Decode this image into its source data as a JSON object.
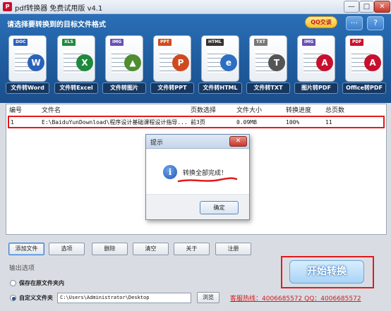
{
  "window": {
    "title": "pdf转换器 免费试用版 v4.1",
    "app_icon": "P",
    "minimize_glyph": "—",
    "maximize_glyph": "□",
    "close_glyph": "✕"
  },
  "format_panel": {
    "heading": "请选择要转换到的目标文件格式",
    "qq_button": "QQ交谈",
    "message_glyph": "···",
    "help_glyph": "?",
    "formats": [
      {
        "tag": "DOC",
        "label": "文件转Word",
        "tag_color": "#2b62b8",
        "glyph": "W",
        "glyph_color": "#2b62b8"
      },
      {
        "tag": "XLS",
        "label": "文件转Excel",
        "tag_color": "#1f8a3c",
        "glyph": "X",
        "glyph_color": "#1f8a3c"
      },
      {
        "tag": "IMG",
        "label": "文件转图片",
        "tag_color": "#6a4fb5",
        "glyph": "▲",
        "glyph_color": "#4f8d2f"
      },
      {
        "tag": "PPT",
        "label": "文件转PPT",
        "tag_color": "#d04a1f",
        "glyph": "P",
        "glyph_color": "#d04a1f"
      },
      {
        "tag": "HTML",
        "label": "文件转HTML",
        "tag_color": "#333333",
        "glyph": "e",
        "glyph_color": "#2c6fc2"
      },
      {
        "tag": "TXT",
        "label": "文件转TXT",
        "tag_color": "#777777",
        "glyph": "T",
        "glyph_color": "#555555"
      },
      {
        "tag": "IMG",
        "label": "图片转PDF",
        "tag_color": "#6a4fb5",
        "glyph": "A",
        "glyph_color": "#c8102e"
      },
      {
        "tag": "PDF",
        "label": "Office转PDF",
        "tag_color": "#c8102e",
        "glyph": "A",
        "glyph_color": "#c8102e"
      }
    ]
  },
  "table": {
    "headers": [
      "编号",
      "文件名",
      "页数选择",
      "文件大小",
      "转换进度",
      "总页数"
    ],
    "rows": [
      [
        "1",
        "E:\\BaiduYunDownload\\程序设计基础课程设计指导...",
        "前3页",
        "0.09MB",
        "100%",
        "11"
      ]
    ]
  },
  "dialog": {
    "title": "提示",
    "close_glyph": "✕",
    "icon_glyph": "i",
    "message": "转换全部完成！",
    "ok_label": "确定"
  },
  "buttons": {
    "add_file": "添加文件",
    "options": "选项",
    "delete": "删除",
    "clear": "清空",
    "about": "关于",
    "register": "注册"
  },
  "output": {
    "label": "输出选项",
    "save_original": "保存在原文件夹内",
    "custom_folder": "自定义文件夹",
    "path": "C:\\Users\\Administrator\\Desktop",
    "browse": "浏览"
  },
  "start_button": "开始转换",
  "hotline": "客服热线：4006685572 QQ：4006685572"
}
